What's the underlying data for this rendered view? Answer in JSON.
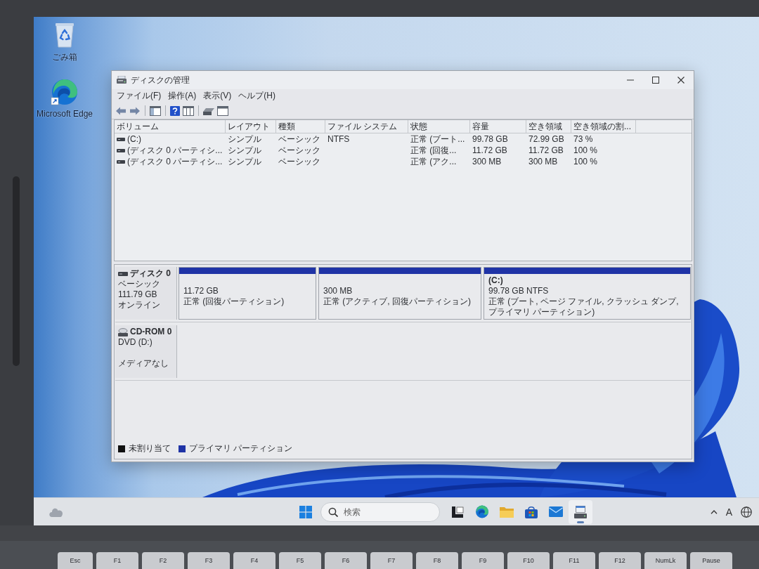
{
  "desktop": {
    "icons": [
      {
        "kind": "recycle-bin",
        "label": "ごみ箱"
      },
      {
        "kind": "browser",
        "label": "Microsoft Edge"
      }
    ]
  },
  "window": {
    "title": "ディスクの管理",
    "menu": [
      "ファイル(F)",
      "操作(A)",
      "表示(V)",
      "ヘルプ(H)"
    ]
  },
  "volume_list": {
    "columns": [
      "ボリューム",
      "レイアウト",
      "種類",
      "ファイル システム",
      "状態",
      "容量",
      "空き領域",
      "空き領域の割..."
    ],
    "rows": [
      {
        "cells": [
          "(C:)",
          "シンプル",
          "ベーシック",
          "NTFS",
          "正常 (ブート...",
          "99.78 GB",
          "72.99 GB",
          "73 %"
        ]
      },
      {
        "cells": [
          "(ディスク 0 パーティシ...",
          "シンプル",
          "ベーシック",
          "",
          "正常 (回復...",
          "11.72 GB",
          "11.72 GB",
          "100 %"
        ]
      },
      {
        "cells": [
          "(ディスク 0 パーティシ...",
          "シンプル",
          "ベーシック",
          "",
          "正常 (アク...",
          "300 MB",
          "300 MB",
          "100 %"
        ]
      }
    ]
  },
  "disks": [
    {
      "kind": "disk",
      "name": "ディスク 0",
      "type": "ベーシック",
      "size": "111.79 GB",
      "status": "オンライン",
      "partitions": [
        {
          "size": "11.72 GB",
          "status": "正常 (回復パーティション)",
          "color": "#1f33a6"
        },
        {
          "size": "300 MB",
          "status": "正常 (アクティブ, 回復パーティション)",
          "color": "#1f33a6"
        },
        {
          "name": "(C:)",
          "size": "99.78 GB NTFS",
          "status": "正常 (ブート, ページ ファイル, クラッシュ ダンプ, プライマリ パーティション)",
          "color": "#1f33a6"
        }
      ]
    },
    {
      "kind": "cd-rom",
      "name": "CD-ROM 0",
      "type": "DVD (D:)",
      "status": "メディアなし"
    }
  ],
  "legend": [
    {
      "label": "未割り当て",
      "color": "#111111"
    },
    {
      "label": "プライマリ パーティション",
      "color": "#1f33a6"
    }
  ],
  "taskbar": {
    "search": {
      "placeholder": "検索"
    },
    "apps": [
      {
        "kind": "task-view",
        "selected": false
      },
      {
        "kind": "browser",
        "selected": false
      },
      {
        "kind": "folder",
        "selected": false
      },
      {
        "kind": "store",
        "selected": false
      },
      {
        "kind": "mail",
        "selected": false
      },
      {
        "kind": "disk-tool",
        "selected": true
      }
    ],
    "ime_mode": "A"
  },
  "keyboard": {
    "keys": [
      "Esc",
      "F1",
      "F2",
      "F3",
      "F4",
      "F5",
      "F6",
      "F7",
      "F8",
      "F9",
      "F10",
      "F11",
      "F12",
      "NumLk",
      "Pause"
    ]
  }
}
